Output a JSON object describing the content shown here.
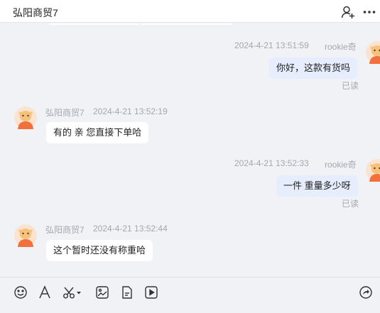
{
  "header": {
    "title": "弘阳商贸7",
    "add_user_icon": "add-user-icon",
    "more_icon": "more-icon"
  },
  "messages": [
    {
      "direction": "out",
      "sender": "rookie奇",
      "time": "2024-4-21 13:51:59",
      "text": "你好，这款有货吗",
      "status": "已读"
    },
    {
      "direction": "in",
      "sender": "弘阳商贸7",
      "time": "2024-4-21 13:52:19",
      "text": "有的 亲 您直接下单哈"
    },
    {
      "direction": "out",
      "sender": "rookie奇",
      "time": "2024-4-21 13:52:33",
      "text": "一件 重量多少呀",
      "status": "已读"
    },
    {
      "direction": "in",
      "sender": "弘阳商贸7",
      "time": "2024-4-21 13:52:44",
      "text": "这个暂时还没有称重哈"
    }
  ],
  "toolbar": {
    "icons": [
      "emoji-icon",
      "font-icon",
      "scissors-icon",
      "image-icon",
      "file-icon",
      "video-icon",
      "share-icon"
    ]
  },
  "colors": {
    "background": "#f1f2f6",
    "outgoing_bubble": "#e6edfc",
    "incoming_bubble": "#ffffff",
    "avatar_orange": "#f2703c",
    "meta_text": "#a3a7b0"
  }
}
